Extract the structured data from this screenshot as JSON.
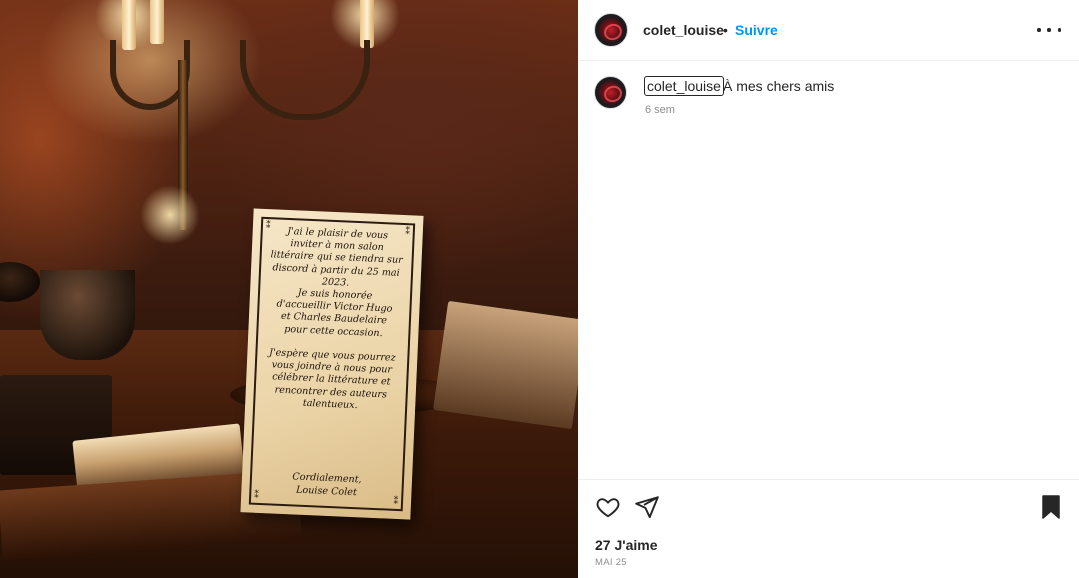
{
  "post": {
    "username": "colet_louise",
    "separator": "•",
    "follow_label": "Suivre",
    "more_icon": "more-horizontal-icon"
  },
  "caption": {
    "username": "colet_louise",
    "text": "À mes chers amis",
    "time": "6 sem"
  },
  "image": {
    "invitation_text": "J'ai le plaisir de vous\ninviter à mon salon\nlittéraire qui se tiendra sur\ndiscord à partir du 25 mai\n2023.\nJe suis honorée\nd'accueillir Victor Hugo\net Charles Baudelaire\npour cette occasion.\n\nJ'espère que vous pourrez\nvous joindre à nous pour\ncélébrer la littérature et\nrencontrer des auteurs\ntalentueux.",
    "signature": "Cordialement,\nLouise Colet"
  },
  "actions": {
    "like_icon": "heart-icon",
    "share_icon": "send-icon",
    "save_icon": "bookmark-icon",
    "likes": "27 J'aime",
    "date": "MAI 25"
  },
  "colors": {
    "link_blue": "#0095f6",
    "text": "#262626",
    "secondary": "#8e8e8e",
    "divider": "#efefef"
  }
}
